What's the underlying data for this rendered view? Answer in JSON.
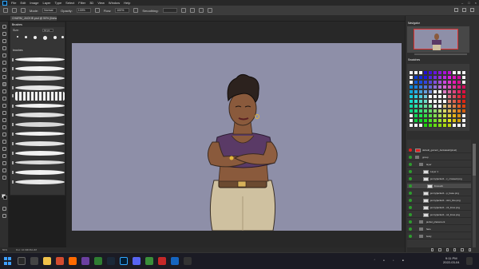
{
  "app": {
    "menu": [
      "File",
      "Edit",
      "Image",
      "Layer",
      "Type",
      "Select",
      "Filter",
      "3D",
      "View",
      "Window",
      "Help"
    ],
    "document_tab": "CHARM_JACKIE.psd @ 50% (linewidth, RGB/8)"
  },
  "options": {
    "mode_label": "Mode:",
    "mode_value": "Normal",
    "opacity_label": "Opacity:",
    "opacity_value": "100%",
    "flow_label": "Flow:",
    "flow_value": "100%",
    "smoothing_label": "Smoothing:"
  },
  "brushes": {
    "title": "Brushes",
    "size_label": "Size:",
    "size_value": "12 px",
    "folder": "brushes"
  },
  "panels": {
    "navigator": "Navigator",
    "swatches": "Swatches",
    "layers": "Layers"
  },
  "layers": [
    {
      "name": "default_gameri_Jenkawalt(pixel)",
      "thumb": "red",
      "indent": 0
    },
    {
      "name": "group",
      "thumb": "folder",
      "indent": 0
    },
    {
      "name": "layer",
      "thumb": "folder",
      "indent": 1
    },
    {
      "name": "Layer 1",
      "thumb": "white",
      "indent": 2
    },
    {
      "name": "jenny/jacket1 - c_crossed.png",
      "thumb": "white",
      "indent": 2
    },
    {
      "name": "linework",
      "thumb": "white",
      "indent": 3
    },
    {
      "name": "jenny/jacket1 - p_base.png",
      "thumb": "white",
      "indent": 2
    },
    {
      "name": "jenny/jacket1 - skin_line.png",
      "thumb": "white",
      "indent": 2
    },
    {
      "name": "jenny/jacket1 - c2_lines.png",
      "thumb": "white",
      "indent": 2
    },
    {
      "name": "jenny/jacket1 - s2_lines.png",
      "thumb": "white",
      "indent": 2
    },
    {
      "name": "jacket_placement",
      "thumb": "folder",
      "indent": 1
    },
    {
      "name": "face",
      "thumb": "folder",
      "indent": 1
    },
    {
      "name": "body",
      "thumb": "folder",
      "indent": 1
    }
  ],
  "status": {
    "zoom": "50%",
    "doc": "Doc: 16.6M/364.2M"
  },
  "clock": {
    "time": "9:11 PM",
    "date": "2022-03-04"
  },
  "colors": {
    "canvas_bg": "#8e8fa8",
    "skin": "#8a5a3c",
    "shirt": "#5a3a66",
    "pants": "#cfc1a0",
    "hair": "#2c221e",
    "accent_red": "#e02020"
  }
}
